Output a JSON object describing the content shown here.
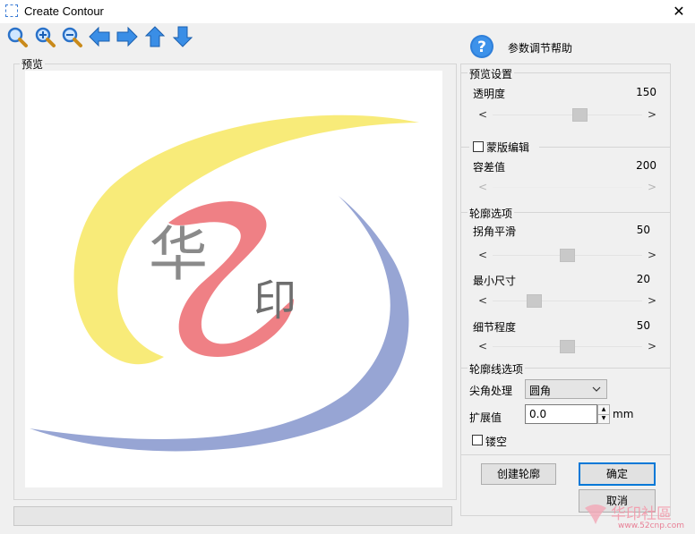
{
  "window": {
    "title": "Create Contour",
    "close_glyph": "✕"
  },
  "toolbar": {
    "icons": [
      "zoom-icon",
      "zoom-in-icon",
      "zoom-out-icon",
      "arrow-left-icon",
      "arrow-right-icon",
      "arrow-up-icon",
      "arrow-down-icon"
    ]
  },
  "help": {
    "label": "参数调节帮助",
    "icon_glyph": "?"
  },
  "preview": {
    "label": "预览",
    "logo_chars": [
      "华",
      "印"
    ]
  },
  "preview_settings": {
    "heading": "预览设置",
    "opacity_label": "透明度",
    "opacity_value": "150",
    "opacity_fraction": 0.59
  },
  "mask": {
    "heading": "蒙版编辑",
    "checked": false,
    "tolerance_label": "容差值",
    "tolerance_value": "200",
    "enabled": false
  },
  "contour_options": {
    "heading": "轮廓选项",
    "smooth_label": "拐角平滑",
    "smooth_value": "50",
    "smooth_fraction": 0.5,
    "min_size_label": "最小尺寸",
    "min_size_value": "20",
    "min_size_fraction": 0.25,
    "detail_label": "细节程度",
    "detail_value": "50",
    "detail_fraction": 0.5
  },
  "contour_line_options": {
    "heading": "轮廓线选项",
    "corner_label": "尖角处理",
    "corner_value": "圆角",
    "expand_label": "扩展值",
    "expand_value": "0.0",
    "expand_unit": "mm",
    "hollow_label": "镂空",
    "hollow_checked": false
  },
  "buttons": {
    "create": "创建轮廓",
    "ok": "确定",
    "cancel": "取消"
  },
  "watermark": {
    "text": "华印社區",
    "sub": "www.52cnp.com"
  },
  "arrows": {
    "left": "<",
    "right": ">",
    "up": "▲",
    "down": "▼",
    "dropdown": "⌄"
  }
}
